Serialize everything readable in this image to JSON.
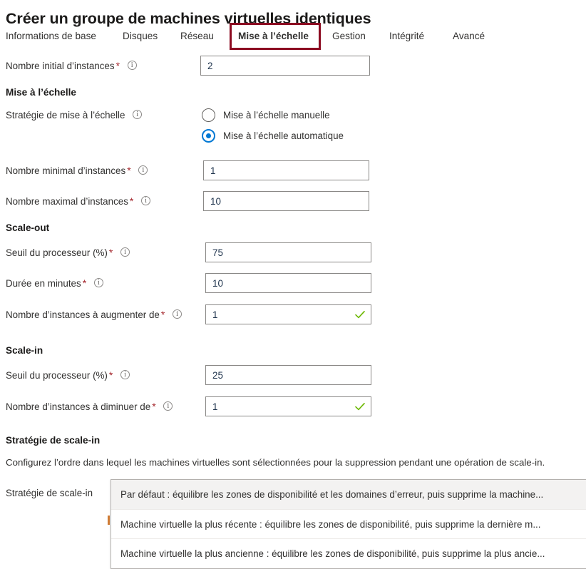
{
  "page": {
    "title": "Créer un groupe de machines virtuelles identiques"
  },
  "colors": {
    "highlight_box": "#8c0b21",
    "accent": "#0078d4",
    "required_asterisk": "#a4262c",
    "valid_check": "#6bb700",
    "input_text": "#21364f"
  },
  "tabs": [
    {
      "label": "Informations de base",
      "selected": false
    },
    {
      "label": "Disques",
      "selected": false
    },
    {
      "label": "Réseau",
      "selected": false
    },
    {
      "label": "Mise à l’échelle",
      "selected": true
    },
    {
      "label": "Gestion",
      "selected": false
    },
    {
      "label": "Intégrité",
      "selected": false
    },
    {
      "label": "Avancé",
      "selected": false
    }
  ],
  "initial_instance_count": {
    "label": "Nombre initial d’instances",
    "required": "*",
    "value": "2"
  },
  "scaling_section": {
    "heading": "Mise à l’échelle",
    "policy_label": "Stratégie de mise à l’échelle",
    "options": [
      {
        "label": "Mise à l’échelle manuelle",
        "checked": false
      },
      {
        "label": "Mise à l’échelle automatique",
        "checked": true
      }
    ],
    "min_instances": {
      "label": "Nombre minimal d’instances",
      "required": "*",
      "value": "1"
    },
    "max_instances": {
      "label": "Nombre maximal d’instances",
      "required": "*",
      "value": "10"
    }
  },
  "scale_out": {
    "heading": "Scale-out",
    "cpu_threshold": {
      "label": "Seuil du processeur (%)",
      "required": "*",
      "value": "75"
    },
    "duration_minutes": {
      "label": "Durée en minutes",
      "required": "*",
      "value": "10"
    },
    "increase_count": {
      "label": "Nombre d’instances à augmenter de",
      "required": "*",
      "value": "1",
      "validated": true
    }
  },
  "scale_in": {
    "heading": "Scale-in",
    "cpu_threshold": {
      "label": "Seuil du processeur (%)",
      "required": "*",
      "value": "25"
    },
    "decrease_count": {
      "label": "Nombre d’instances à diminuer de",
      "required": "*",
      "value": "1",
      "validated": true
    }
  },
  "scale_in_policy": {
    "heading": "Stratégie de scale-in",
    "description": "Configurez l’ordre dans lequel les machines virtuelles sont sélectionnées pour la suppression pendant une opération de scale-in.",
    "field_label": "Stratégie de scale-in",
    "options": [
      {
        "label": "Par défaut : équilibre les zones de disponibilité et les domaines d’erreur, puis supprime la machine...",
        "highlighted": true
      },
      {
        "label": "Machine virtuelle la plus récente : équilibre les zones de disponibilité, puis supprime la dernière m...",
        "highlighted": false
      },
      {
        "label": "Machine virtuelle la plus ancienne : équilibre les zones de disponibilité, puis supprime la plus ancie...",
        "highlighted": false
      }
    ]
  }
}
